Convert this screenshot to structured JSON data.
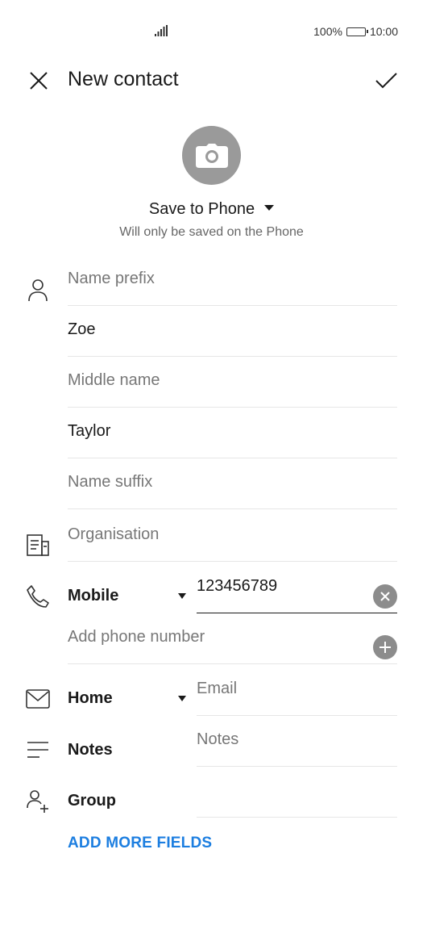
{
  "status_bar": {
    "battery_percent": "100%",
    "time": "10:00"
  },
  "header": {
    "title": "New contact",
    "close_icon": "close-icon",
    "save_icon": "checkmark-icon"
  },
  "photo": {
    "icon": "camera-icon"
  },
  "account": {
    "label": "Save to Phone",
    "hint": "Will only be saved on the Phone"
  },
  "name": {
    "prefix_placeholder": "Name prefix",
    "first_name": "Zoe",
    "middle_placeholder": "Middle name",
    "last_name": "Taylor",
    "suffix_placeholder": "Name suffix"
  },
  "organisation": {
    "placeholder": "Organisation"
  },
  "phone": {
    "type": "Mobile",
    "number": "123456789",
    "add_placeholder": "Add phone number"
  },
  "email": {
    "type": "Home",
    "placeholder": "Email"
  },
  "notes": {
    "label": "Notes",
    "placeholder": "Notes"
  },
  "group": {
    "label": "Group"
  },
  "add_more_label": "ADD MORE FIELDS",
  "colors": {
    "accent": "#1c7ee0",
    "avatar_bg": "#9a9a9a",
    "icon_gray": "#8c8c8c"
  }
}
